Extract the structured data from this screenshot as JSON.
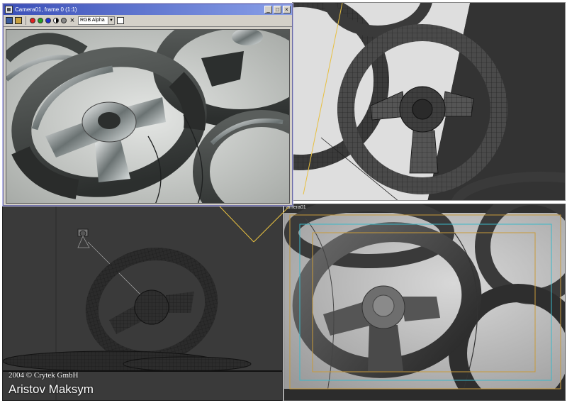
{
  "render_window": {
    "title": "Camera01, frame 0 (1:1)",
    "channel_select": "RGB Alpha",
    "buttons": {
      "minimize": "_",
      "maximize": "□",
      "close": "×"
    }
  },
  "viewports": {
    "bottom_right_label": "amera01"
  },
  "credits": {
    "copyright": "2004 © Crytek GmbH",
    "author": "Aristov Maksym"
  },
  "colors": {
    "titlebar_start": "#3a4fb8",
    "titlebar_end": "#8aa0e8",
    "ui_face": "#d4d0c8",
    "safe_frame_orange": "#c89a3a",
    "safe_frame_cyan": "#3ab8c8",
    "wire_yellow": "#e8c040"
  },
  "icons": {
    "app": "max-app-icon",
    "save": "save-icon",
    "clone": "clone-icon",
    "red_channel": "red-channel-dot",
    "green_channel": "green-channel-dot",
    "blue_channel": "blue-channel-dot",
    "alpha": "alpha-channel-icon",
    "mono": "monochrome-icon",
    "clear": "clear-x-icon"
  }
}
